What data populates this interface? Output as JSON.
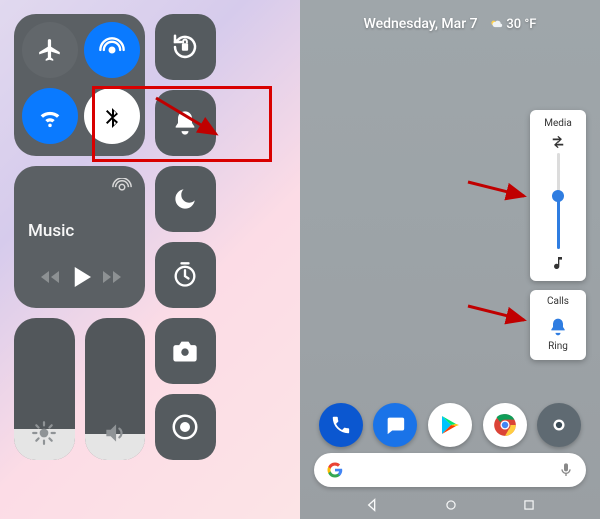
{
  "ios": {
    "music_label": "Music",
    "brightness_pct": 22,
    "volume_pct": 18
  },
  "android": {
    "status": {
      "day_date": "Wednesday, Mar 7",
      "temp": "30 °F"
    },
    "media_popup": {
      "label": "Media",
      "volume_pct": 55
    },
    "calls_popup": {
      "label_top": "Calls",
      "label_bottom": "Ring"
    },
    "search_placeholder": "",
    "dock": {
      "apps": [
        {
          "name": "phone",
          "bg": "#0b57d0"
        },
        {
          "name": "messages",
          "bg": "#1a73e8"
        },
        {
          "name": "play",
          "bg": "#ffffff"
        },
        {
          "name": "chrome",
          "bg": "#ffffff"
        },
        {
          "name": "camera",
          "bg": "#5f6a72"
        }
      ]
    }
  }
}
